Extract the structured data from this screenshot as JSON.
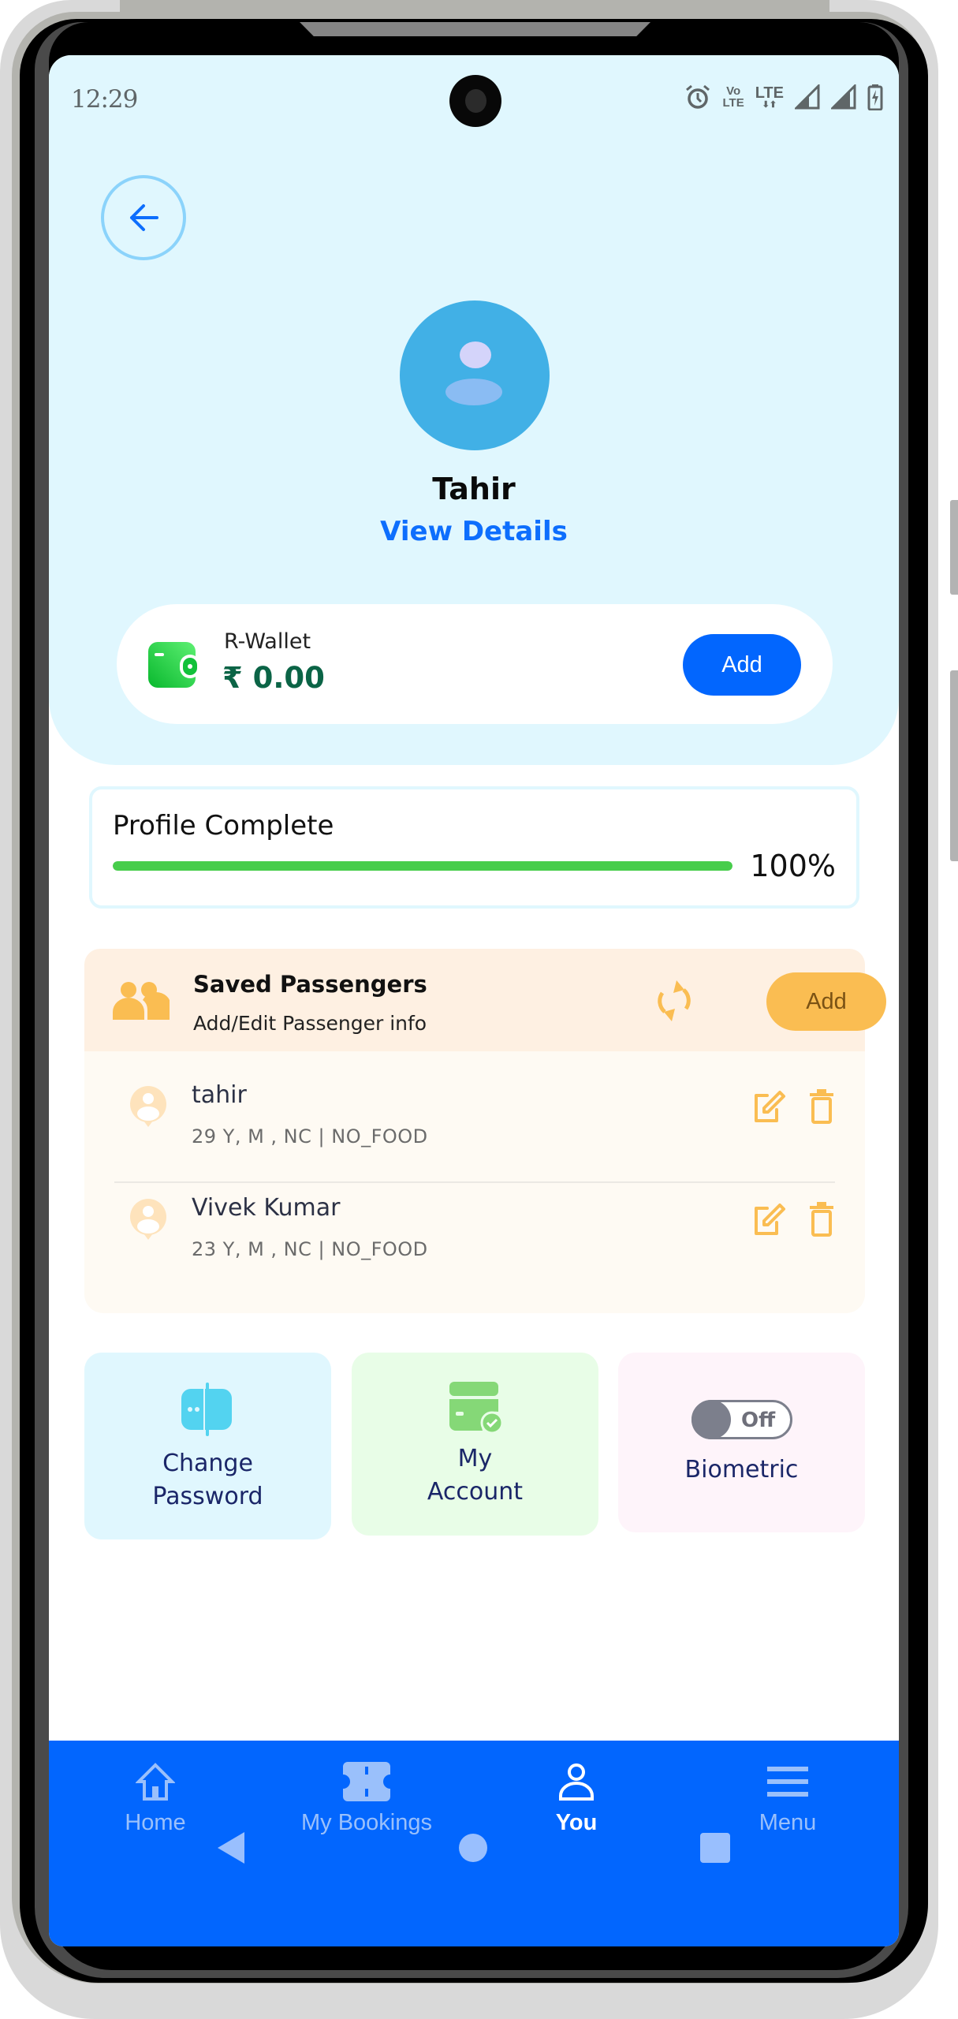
{
  "status_bar": {
    "time": "12:29",
    "icons": [
      "alarm-icon",
      "volte-icon",
      "lte-data-icon",
      "signal-icon",
      "signal-icon",
      "battery-charging-icon"
    ],
    "volte_top": "Vo",
    "volte_bottom": "LTE",
    "lte_label": "LTE"
  },
  "header": {
    "back_icon": "arrow-left-icon",
    "user_name": "Tahir",
    "view_details_label": "View Details"
  },
  "wallet": {
    "icon": "wallet-icon",
    "label": "R-Wallet",
    "amount": "₹ 0.00",
    "add_label": "Add"
  },
  "profile": {
    "label": "Profile Complete",
    "percent_text": "100%",
    "progress": 1.0
  },
  "saved_passengers": {
    "icon": "users-icon",
    "title": "Saved Passengers",
    "subtitle": "Add/Edit Passenger info",
    "refresh_icon": "refresh-icon",
    "add_label": "Add",
    "passengers": [
      {
        "name": "tahir",
        "details": "29 Y, M , NC | NO_FOOD"
      },
      {
        "name": "Vivek Kumar",
        "details": "23 Y, M , NC | NO_FOOD"
      }
    ]
  },
  "tiles": [
    {
      "icon": "password-icon",
      "label_line1": "Change",
      "label_line2": "Password"
    },
    {
      "icon": "account-card-icon",
      "label_line1": "My",
      "label_line2": "Account"
    },
    {
      "icon": "toggle-icon",
      "label": "Biometric",
      "toggle_text": "Off",
      "toggle_on": false
    }
  ],
  "bottom_nav": {
    "items": [
      {
        "label": "Home",
        "icon": "home-icon",
        "active": false
      },
      {
        "label": "My Bookings",
        "icon": "ticket-icon",
        "active": false
      },
      {
        "label": "You",
        "icon": "user-icon",
        "active": true
      },
      {
        "label": "Menu",
        "icon": "menu-icon",
        "active": false
      }
    ]
  },
  "system_nav": [
    "back",
    "home",
    "recents"
  ],
  "colors": {
    "primary": "#0266fe",
    "header_bg": "#e0f7fe",
    "progress": "#47cd4b",
    "passenger_accent": "#fabd52",
    "wallet_amount": "#0b6446"
  }
}
